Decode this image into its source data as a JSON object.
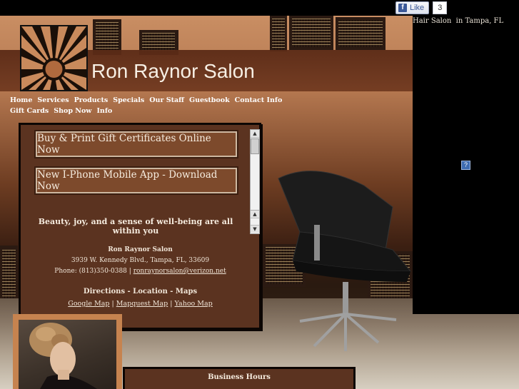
{
  "facebook": {
    "like_label": "Like",
    "like_count": "3",
    "icon": "facebook-f-icon"
  },
  "seo": {
    "text": "Hair Salon  in Tampa, FL"
  },
  "site": {
    "title": "Ron Raynor Salon"
  },
  "nav": {
    "items": [
      "Home",
      "Services",
      "Products",
      "Specials",
      "Our Staff",
      "Guestbook",
      "Contact Info",
      "Gift Cards",
      "Shop Now",
      "Info"
    ]
  },
  "content": {
    "buttons": {
      "gift": "Buy & Print Gift Certificates Online Now",
      "app": "New I-Phone Mobile App - Download Now"
    },
    "tagline": "Beauty, joy, and a sense of well-being are all within you",
    "salon_name": "Ron Raynor Salon",
    "address": "3939 W. Kennedy Blvd., Tampa, FL, 33609",
    "phone_prefix": "Phone: (813)350-0388 |",
    "email": "ronraynorsalon@verizon.net",
    "directions_title": "Directions - Location - Maps",
    "maps": {
      "google": "Google Map",
      "mapquest": "Mapquest Map",
      "yahoo": "Yahoo Map",
      "sep": "|"
    }
  },
  "hours": {
    "title": "Business Hours"
  },
  "colors": {
    "accent": "#5b3320",
    "frame": "#c6834f",
    "text": "#f6ecdf"
  }
}
